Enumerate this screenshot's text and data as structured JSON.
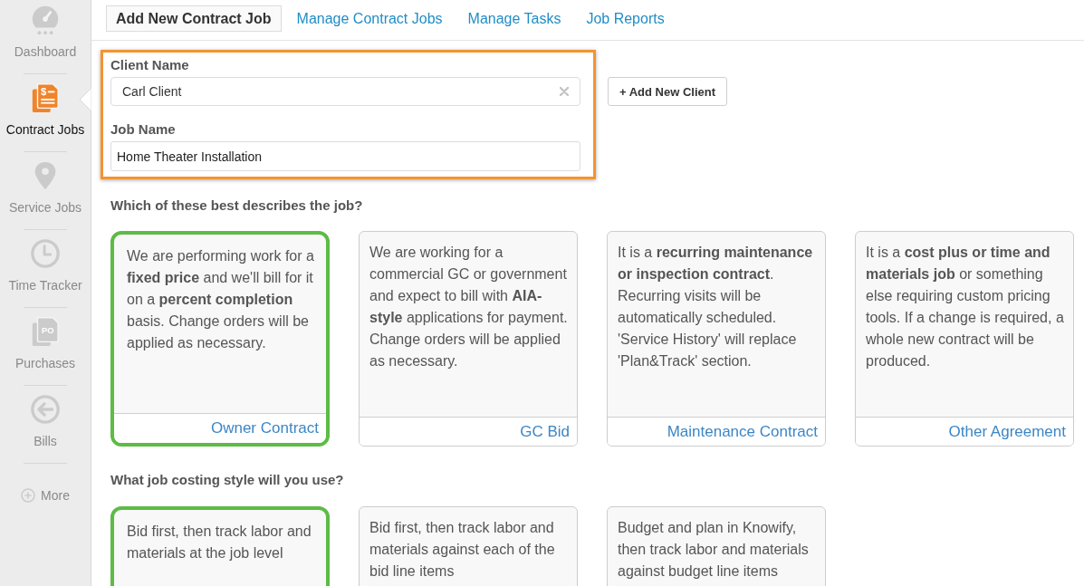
{
  "sidebar": {
    "items": [
      {
        "label": "Dashboard",
        "selected": false
      },
      {
        "label": "Contract Jobs",
        "selected": true,
        "icon_text": "$"
      },
      {
        "label": "Service Jobs",
        "selected": false
      },
      {
        "label": "Time Tracker",
        "selected": false
      },
      {
        "label": "Purchases",
        "selected": false,
        "icon_text": "PO"
      },
      {
        "label": "Bills",
        "selected": false
      }
    ],
    "more": "More"
  },
  "tabs": [
    {
      "label": "Add New Contract Job",
      "selected": true
    },
    {
      "label": "Manage Contract Jobs",
      "selected": false
    },
    {
      "label": "Manage Tasks",
      "selected": false
    },
    {
      "label": "Job Reports",
      "selected": false
    }
  ],
  "form": {
    "client_name": {
      "label": "Client Name",
      "value": "Carl Client"
    },
    "job_name": {
      "label": "Job Name",
      "value": "Home Theater Installation"
    },
    "add_client_button": "+ Add New Client"
  },
  "job_type": {
    "question": "Which of these best describes the job?",
    "options": [
      {
        "description": "We are performing work for a **fixed price** and we'll bill for it on a **percent completion** basis. Change orders will be applied as necessary.",
        "title": "Owner Contract",
        "selected": true
      },
      {
        "description": "We are working for a commercial GC or government and expect to bill with **AIA-style** applications for payment. Change orders will be applied as necessary.",
        "title": "GC Bid",
        "selected": false
      },
      {
        "description": "It is a **recurring maintenance or inspection contract**. Recurring visits will be automatically scheduled. 'Service History' will replace 'Plan&Track' section.",
        "title": "Maintenance Contract",
        "selected": false
      },
      {
        "description": "It is a **cost plus or time and materials job** or something else requiring custom pricing tools. If a change is required, a whole new contract will be produced.",
        "title": "Other Agreement",
        "selected": false
      }
    ]
  },
  "costing_style": {
    "question": "What job costing style will you use?",
    "options": [
      {
        "description": "Bid first, then track labor and materials at the job level",
        "selected": true
      },
      {
        "description": "Bid first, then track labor and materials against each of the bid line items",
        "selected": false
      },
      {
        "description": "Budget and plan in Knowify, then track labor and materials against budget line items",
        "selected": false
      }
    ]
  }
}
